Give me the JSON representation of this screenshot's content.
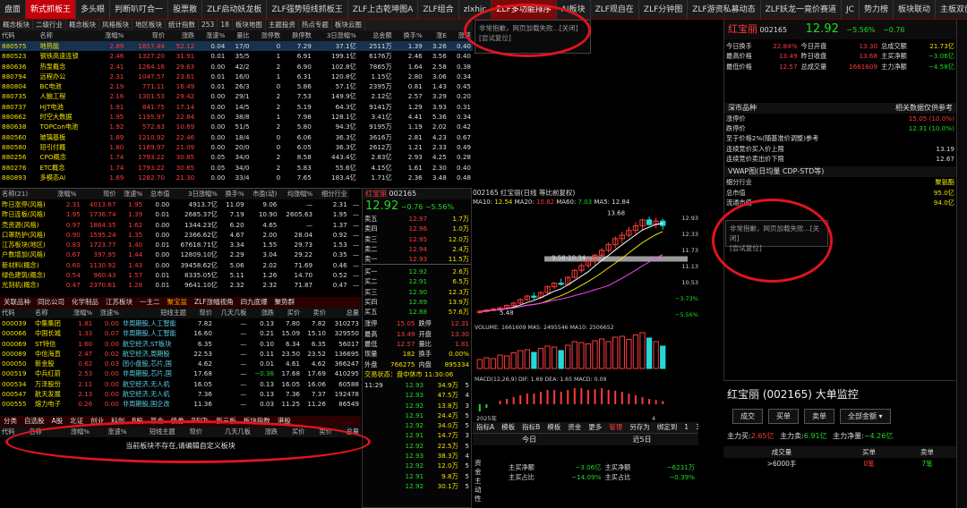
{
  "top_tabs": [
    {
      "label": "盘面",
      "style": ""
    },
    {
      "label": "新式抓板王",
      "style": "active"
    },
    {
      "label": "多头眼",
      "style": ""
    },
    {
      "label": "判断叭叮合一",
      "style": ""
    },
    {
      "label": "股票散",
      "style": ""
    },
    {
      "label": "ZLF启动妖龙板",
      "style": ""
    },
    {
      "label": "ZLF强势短线抓板王",
      "style": ""
    },
    {
      "label": "ZLF上古乾坤图A",
      "style": ""
    },
    {
      "label": "ZLF组合",
      "style": ""
    },
    {
      "label": "zlxhjc",
      "style": ""
    },
    {
      "label": "ZLF多功能排序",
      "style": "hl"
    },
    {
      "label": "AI板块",
      "style": ""
    },
    {
      "label": "ZLF观自在",
      "style": ""
    },
    {
      "label": "ZLF分钟图",
      "style": ""
    },
    {
      "label": "ZLF游资私募动态",
      "style": ""
    },
    {
      "label": "ZLF妖龙一竟价赛道",
      "style": ""
    },
    {
      "label": "JC",
      "style": ""
    },
    {
      "label": "势力榜",
      "style": ""
    },
    {
      "label": "板块联动",
      "style": ""
    },
    {
      "label": "主板双创",
      "style": ""
    },
    {
      "label": "涨幅排行",
      "style": ""
    }
  ],
  "sub_tabs": [
    "概念板块",
    "二级行业",
    "概念板块",
    "风格板块",
    "地区板块",
    "统计指数",
    "253",
    "18",
    "板块地图",
    "主题投资",
    "热点专题",
    "板块云图"
  ],
  "concept_table": {
    "headers": [
      "代码",
      "名称",
      "涨幅%",
      "现价",
      "涨跌",
      "涨速%",
      "量比",
      "涨停数",
      "跌停数",
      "3日涨幅%",
      "总金额",
      "换手%",
      "涨E",
      "涨速"
    ],
    "rows": [
      [
        "880575",
        "地热能",
        "2.89",
        "1857.44",
        "52.12",
        "0.04",
        "17/0",
        "0",
        "7.29",
        "37.1亿",
        "2511万",
        "1.39",
        "3.26",
        "0.40"
      ],
      [
        "880523",
        "钢铁高速连锁",
        "2.46",
        "1327.20",
        "31.91",
        "0.01",
        "35/5",
        "1",
        "6.91",
        "199.1亿",
        "6176万",
        "2.46",
        "3.56",
        "0.40"
      ],
      [
        "880636",
        "热泵概念",
        "2.41",
        "1264.16",
        "29.63",
        "0.00",
        "42/2",
        "2",
        "6.90",
        "102.8亿",
        "7865万",
        "1.64",
        "2.58",
        "0.38"
      ],
      [
        "880794",
        "远程办公",
        "2.31",
        "1047.57",
        "23.61",
        "0.01",
        "16/0",
        "1",
        "6.31",
        "120.8亿",
        "1.15亿",
        "2.80",
        "3.06",
        "0.34"
      ],
      [
        "880804",
        "BC电池",
        "2.19",
        "771.11",
        "16.49",
        "0.01",
        "26/3",
        "0",
        "5.86",
        "57.1亿",
        "2395万",
        "0.81",
        "1.43",
        "0.45"
      ],
      [
        "880735",
        "人脑工程",
        "2.16",
        "1301.53",
        "29.42",
        "0.00",
        "29/1",
        "2",
        "7.53",
        "149.9亿",
        "2.12亿",
        "2.57",
        "3.29",
        "0.20"
      ],
      [
        "880737",
        "HJT电池",
        "1.91",
        "841.75",
        "17.14",
        "0.00",
        "14/5",
        "2",
        "5.19",
        "64.3亿",
        "9141万",
        "1.29",
        "3.93",
        "0.31"
      ],
      [
        "880662",
        "时空大数据",
        "1.95",
        "1195.97",
        "22.84",
        "0.00",
        "38/8",
        "1",
        "7.98",
        "128.1亿",
        "3.41亿",
        "4.41",
        "5.36",
        "0.34"
      ],
      [
        "880638",
        "TOPCon电池",
        "1.92",
        "572.83",
        "10.69",
        "0.00",
        "51/5",
        "2",
        "5.80",
        "94.3亿",
        "9195万",
        "1.19",
        "2.02",
        "0.42"
      ],
      [
        "880560",
        "玻璃基板",
        "1.89",
        "1210.92",
        "22.46",
        "0.00",
        "18/4",
        "0",
        "6.06",
        "36.3亿",
        "3616万",
        "2.81",
        "4.23",
        "0.67"
      ],
      [
        "880580",
        "短引付概",
        "1.80",
        "1169.97",
        "21.09",
        "0.00",
        "20/0",
        "0",
        "6.05",
        "36.3亿",
        "2612万",
        "1.21",
        "2.33",
        "0.49"
      ],
      [
        "880256",
        "CPO概念",
        "1.74",
        "1793.22",
        "30.85",
        "0.05",
        "34/0",
        "2",
        "8.58",
        "443.4亿",
        "2.83亿",
        "2.93",
        "4.25",
        "0.28"
      ],
      [
        "880276",
        "ETC概念",
        "1.74",
        "1793.22",
        "30.85",
        "0.05",
        "34/0",
        "2",
        "5.83",
        "55.6亿",
        "4.15亿",
        "1.61",
        "2.30",
        "0.40"
      ],
      [
        "880893",
        "多模态AI",
        "1.69",
        "1282.70",
        "21.30",
        "0.00",
        "33/4",
        "0",
        "7.65",
        "183.4亿",
        "1.71亿",
        "2.36",
        "3.48",
        "0.48"
      ]
    ]
  },
  "style_table": {
    "headers": [
      "名称(21)",
      "涨幅%",
      "现价",
      "涨速%",
      "总市值",
      "3日涨幅%",
      "换手%",
      "市盈(动)",
      "均涨幅%",
      "细分行业"
    ],
    "rows": [
      [
        "昨日涨停(风格)",
        "2.31",
        "4013.67",
        "1.95",
        "0.00",
        "4913.7亿",
        "11.09",
        "9.06",
        "—",
        "2.31",
        "—"
      ],
      [
        "昨日连板(风格)",
        "1.95",
        "1736.74",
        "1.39",
        "0.01",
        "2685.37亿",
        "7.19",
        "10.90",
        "2605.63",
        "1.95",
        "—"
      ],
      [
        "壳资源(风格)",
        "0.97",
        "1864.35",
        "1.62",
        "0.00",
        "1344.23亿",
        "6.20",
        "4.65",
        "—",
        "1.37",
        "—"
      ],
      [
        "口罩防护(风格)",
        "0.90",
        "1595.24",
        "1.35",
        "0.00",
        "2366.62亿",
        "4.67",
        "2.00",
        "28.04",
        "0.92",
        "—"
      ],
      [
        "江苏板块(地区)",
        "0.83",
        "1723.77",
        "1.40",
        "0.01",
        "67618.71亿",
        "3.34",
        "1.55",
        "29.73",
        "1.53",
        "—"
      ],
      [
        "户数增加(风格)",
        "0.67",
        "397.95",
        "1.44",
        "0.00",
        "12809.10亿",
        "2.29",
        "3.04",
        "29.22",
        "0.35",
        "—"
      ],
      [
        "新材料(概念)",
        "0.60",
        "1130.92",
        "1.43",
        "0.00",
        "39458.62亿",
        "5.06",
        "2.02",
        "71.69",
        "0.46",
        "—"
      ],
      [
        "绿色建筑(概念)",
        "0.54",
        "960.43",
        "1.57",
        "0.01",
        "8335.05亿",
        "5.11",
        "1.26",
        "14.70",
        "0.52",
        "—"
      ],
      [
        "光刻机(概念)",
        "0.47",
        "2370.61",
        "1.28",
        "0.01",
        "9641.10亿",
        "2.32",
        "2.32",
        "71.87",
        "0.47",
        "—"
      ]
    ]
  },
  "mid_tabs": [
    "关联品种",
    "同比公司",
    "化学制品",
    "江苏板块",
    "一主二",
    "聚宝盆",
    "ZLF涨幅视角",
    "四九底爆",
    "聚势群"
  ],
  "stock_table": {
    "headers": [
      "代码",
      "名称",
      "涨幅%",
      "涨速%",
      "短线主题",
      "现价",
      "几天几板",
      "涨跌",
      "买价",
      "卖价",
      "总量"
    ],
    "rows": [
      [
        "000039",
        "中集集团",
        "1.81",
        "0.00",
        "非周期股,人工智能",
        "7.82",
        "—",
        "0.13",
        "7.80",
        "7.82",
        "310273"
      ],
      [
        "000066",
        "中国长城",
        "1.33",
        "0.07",
        "非周期股,人工智能",
        "16.60",
        "—",
        "0.21",
        "15.09",
        "15.10",
        "329550"
      ],
      [
        "000069",
        "ST特信",
        "1.60",
        "0.00",
        "航空经济,ST板块",
        "6.35",
        "—",
        "0.10",
        "6.34",
        "6.35",
        "56017"
      ],
      [
        "000089",
        "中信海直",
        "2.47",
        "0.02",
        "航空经济,周期股",
        "22.53",
        "—",
        "0.11",
        "23.50",
        "23.52",
        "136695"
      ],
      [
        "000050",
        "新金股",
        "0.62",
        "0.03",
        "团小盘股,芯片,国",
        "4.62",
        "—",
        "0.01",
        "4.61",
        "4.62",
        "366247"
      ],
      [
        "000519",
        "中兵红箭",
        "2.53",
        "0.00",
        "非周期股,芯片,国",
        "17.68",
        "—",
        "−0.36",
        "17.68",
        "17.69",
        "410295"
      ],
      [
        "000534",
        "万泽股份",
        "2.11",
        "0.00",
        "航空经济,无人机",
        "16.05",
        "—",
        "0.13",
        "16.05",
        "16.06",
        "60588"
      ],
      [
        "000547",
        "航天发展",
        "2.13",
        "0.00",
        "航空经济,无人机",
        "7.36",
        "—",
        "0.13",
        "7.36",
        "7.37",
        "192478"
      ],
      [
        "000555",
        "熔力电子",
        "0.26",
        "0.00",
        "非周期股,国企改",
        "11.36",
        "—",
        "0.03",
        "11.25",
        "11.26",
        "86549"
      ]
    ]
  },
  "bottom_tabs": [
    "分类",
    "自选股",
    "A股",
    "北证",
    "创业",
    "科创",
    "B股",
    "基金",
    "债券",
    "REITs",
    "新三板",
    "板块指数",
    "港股"
  ],
  "bottom_headers": [
    "代码",
    "名称",
    "涨幅%",
    "涨速%",
    "短线主题",
    "现价",
    "几天几板",
    "涨跌",
    "买价",
    "卖价",
    "总量"
  ],
  "bottom_empty_msg": "当前板块不存在,请编辑自定义板块",
  "popup1": {
    "line1": "非常抱歉，网页加载失败...[关闭]",
    "line2": "[尝试复位]"
  },
  "popup2": {
    "line1": "非常抱歉，网页加载失败...[关闭]",
    "line2": "[尝试复位]"
  },
  "quote": {
    "name": "红宝丽",
    "code": "002165",
    "price": "12.92",
    "change": "−0.76",
    "pct": "−5.56%",
    "book_sell": [
      [
        "卖五",
        "12.97",
        "1.7万"
      ],
      [
        "卖四",
        "12.96",
        "1.0万"
      ],
      [
        "卖三",
        "12.95",
        "12.0万"
      ],
      [
        "卖二",
        "12.94",
        "2.4万"
      ],
      [
        "卖一",
        "12.93",
        "11.5万"
      ]
    ],
    "book_buy": [
      [
        "买一",
        "12.92",
        "2.6万"
      ],
      [
        "买二",
        "12.91",
        "6.5万"
      ],
      [
        "买三",
        "12.90",
        "12.3万"
      ],
      [
        "买四",
        "12.89",
        "13.9万"
      ],
      [
        "买五",
        "12.88",
        "57.6万"
      ]
    ],
    "stats": [
      [
        "涨停",
        "15.05",
        "跌停",
        "12.31"
      ],
      [
        "最高",
        "13.49",
        "开盘",
        "13.30"
      ],
      [
        "最低",
        "12.57",
        "量比",
        "1.81"
      ],
      [
        "现量",
        "182",
        "换手",
        "0.00%"
      ],
      [
        "外盘",
        "766275",
        "内盘",
        "895334"
      ]
    ],
    "ticks_label": "交易状态：盘中休市 11:30:06",
    "ticks": [
      [
        "11:29",
        "12.93",
        "34.9万",
        "5"
      ],
      [
        "",
        "12.93",
        "47.5万",
        "4"
      ],
      [
        "",
        "12.92",
        "13.8万",
        "3"
      ],
      [
        "",
        "12.91",
        "24.4万",
        "5"
      ],
      [
        "",
        "12.92",
        "34.0万",
        "5"
      ],
      [
        "",
        "12.91",
        "14.7万",
        "3"
      ],
      [
        "",
        "12.92",
        "22.5万",
        "5"
      ],
      [
        "",
        "12.93",
        "38.3万",
        "4"
      ],
      [
        "",
        "12.92",
        "12.0万",
        "5"
      ],
      [
        "",
        "12.91",
        "9.8万",
        "5"
      ],
      [
        "",
        "12.92",
        "30.1万",
        "5"
      ]
    ]
  },
  "chart_data": {
    "type": "candlestick",
    "title": "002165 红宝丽(日线 等比前复权)",
    "indicators": {
      "MA5": "12.84",
      "MA10": "12.54",
      "MA20": "10.82",
      "MA60": "7.03"
    },
    "annotations": [
      "13.68",
      "9.58-10.34",
      "5.48"
    ],
    "volume_label": "VOLUME: 1661609 MA5: 2495546 MA10: 2506652",
    "macd_label": "MACD(12,26,9) DIF: 1.69 DEA: 1.65 MACD: 0.09",
    "axis_right": [
      "12.93",
      "12.33",
      "11.73",
      "11.13",
      "10.53",
      "−3.73%",
      "−5.56%"
    ],
    "x_labels": [
      "2025年",
      "4"
    ],
    "candles": [
      [
        5.5,
        5.7,
        5.4,
        5.6
      ],
      [
        5.6,
        5.8,
        5.5,
        5.7
      ],
      [
        5.7,
        5.9,
        5.6,
        5.8
      ],
      [
        5.8,
        6.0,
        5.7,
        5.9
      ],
      [
        5.9,
        6.2,
        5.8,
        6.1
      ],
      [
        6.1,
        6.4,
        6.0,
        6.3
      ],
      [
        6.3,
        6.7,
        6.2,
        6.6
      ],
      [
        6.6,
        7.0,
        6.5,
        6.9
      ],
      [
        6.9,
        7.2,
        6.6,
        6.8
      ],
      [
        6.8,
        7.3,
        6.7,
        7.2
      ],
      [
        7.2,
        7.8,
        7.1,
        7.7
      ],
      [
        7.7,
        8.1,
        7.5,
        8.0
      ],
      [
        8.0,
        8.4,
        7.8,
        7.9
      ],
      [
        7.9,
        8.6,
        7.8,
        8.5
      ],
      [
        8.5,
        9.2,
        8.4,
        9.1
      ],
      [
        9.1,
        9.7,
        8.9,
        9.5
      ],
      [
        9.5,
        10.1,
        9.3,
        9.9
      ],
      [
        9.9,
        10.5,
        9.6,
        10.4
      ],
      [
        10.4,
        11.0,
        10.1,
        10.8
      ],
      [
        10.8,
        11.5,
        10.6,
        11.3
      ],
      [
        11.3,
        12.0,
        11.0,
        11.8
      ],
      [
        11.8,
        12.4,
        11.4,
        12.1
      ],
      [
        12.1,
        12.8,
        11.9,
        12.5
      ],
      [
        12.5,
        13.2,
        12.2,
        12.9
      ],
      [
        12.9,
        13.5,
        12.5,
        13.4
      ],
      [
        13.4,
        13.68,
        12.9,
        13.0
      ],
      [
        13.0,
        13.6,
        12.7,
        13.3
      ],
      [
        13.3,
        13.49,
        12.57,
        12.92
      ]
    ],
    "volume": [
      20,
      24,
      22,
      30,
      28,
      35,
      40,
      42,
      36,
      45,
      50,
      48,
      40,
      52,
      60,
      58,
      55,
      62,
      66,
      60,
      70,
      72,
      65,
      75,
      80,
      68,
      60,
      50
    ],
    "macd": [
      -0.2,
      -0.1,
      0,
      0.1,
      0.15,
      0.2,
      0.25,
      0.3,
      0.3,
      0.35,
      0.4,
      0.4,
      0.35,
      0.4,
      0.45,
      0.45,
      0.4,
      0.42,
      0.45,
      0.4,
      0.38,
      0.35,
      0.3,
      0.25,
      0.2,
      0.15,
      0.12,
      0.09
    ]
  },
  "chart_bottom_tabs": [
    "指标A",
    "模板",
    "指标B",
    "模板",
    "资金",
    "更多",
    "管理",
    "另存为",
    "绑定到",
    "1",
    "3",
    "5"
  ],
  "right_info": {
    "name": "红宝丽",
    "code": "002165",
    "price": "12.92",
    "pct": "−5.56%",
    "chg": "−0.76",
    "rows": [
      [
        "今日换手",
        "22.84%",
        "今日开盘",
        "13.30",
        "总成交额",
        "21.73亿"
      ],
      [
        "最高价格",
        "13.49",
        "昨日收盘",
        "13.68",
        "主买净额",
        "−3.06亿"
      ],
      [
        "最低价格",
        "12.57",
        "总成交量",
        "1661609",
        "主力净额",
        "−4.58亿"
      ]
    ],
    "sec_title": "深市品种",
    "sec_right": "相关数据仅供参考",
    "sec_rows": [
      [
        "涨停价",
        "15.05 (10.0%)"
      ],
      [
        "跌停价",
        "12.31 (10.0%)"
      ],
      [
        "至于价格2%(随基准价调整)参考",
        ""
      ],
      [
        "连续竞价买入价上限",
        "13.19"
      ],
      [
        "连续竞价卖出价下限",
        "12.67"
      ]
    ],
    "vwap": "VWAP图(日均量 CDP-STD等)",
    "segments": [
      [
        "细分行业",
        "聚氨酯"
      ],
      [
        "总市值",
        "95.0亿"
      ],
      [
        "流通市值",
        "94.0亿"
      ]
    ]
  },
  "monitor": {
    "title": "红宝丽 (002165) 大单监控",
    "btns": [
      "成交",
      "买单",
      "卖单"
    ],
    "select": "全部金额",
    "net": [
      [
        "主力买:",
        "2.65亿"
      ],
      [
        "主力卖:",
        "6.91亿"
      ],
      [
        "主力净量:",
        "−4.26亿"
      ]
    ],
    "cols": [
      "成交量",
      "买单",
      "卖单"
    ],
    "row": [
      ">6000手",
      "0笔",
      "7笔"
    ]
  },
  "flow": {
    "tabs": [
      "今日",
      "近5日"
    ],
    "side": "资金主动性",
    "rows": [
      [
        "主买净额",
        "−3.06亿",
        "主买净额",
        "−6231万"
      ],
      [
        "主买占比",
        "−14.09%",
        "主买占比",
        "−0.39%"
      ]
    ]
  }
}
